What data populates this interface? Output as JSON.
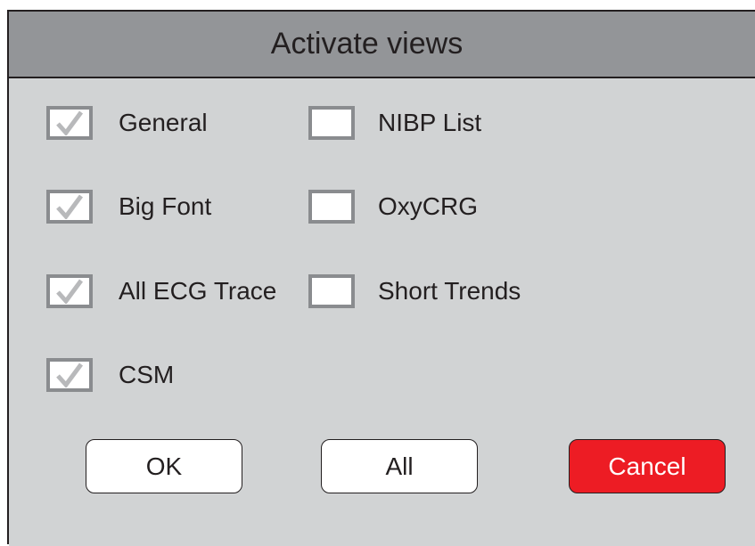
{
  "dialog": {
    "title": "Activate views"
  },
  "views_left": [
    {
      "label": "General",
      "checked": true
    },
    {
      "label": "Big Font",
      "checked": true
    },
    {
      "label": "All ECG Trace",
      "checked": true
    },
    {
      "label": "CSM",
      "checked": true
    }
  ],
  "views_right": [
    {
      "label": "NIBP List",
      "checked": false
    },
    {
      "label": "OxyCRG",
      "checked": false
    },
    {
      "label": "Short Trends",
      "checked": false
    }
  ],
  "buttons": {
    "ok_label": "OK",
    "all_label": "All",
    "cancel_label": "Cancel"
  },
  "colors": {
    "title_bar": "#939598",
    "panel": "#d1d3d4",
    "checkbox_border": "#8a8c8f",
    "checkmark": "#b8b9bb",
    "cancel": "#ed1c24"
  },
  "icons": {
    "checkmark": "check-icon"
  }
}
